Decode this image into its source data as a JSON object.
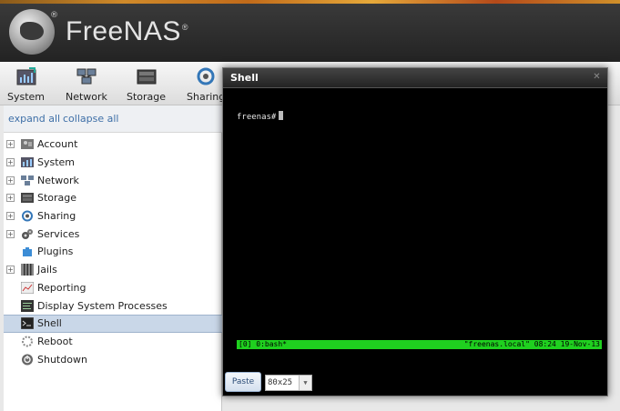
{
  "brand": {
    "name": "FreeNAS",
    "reg": "®"
  },
  "toolbar": [
    {
      "label": "System",
      "icon": "system-icon"
    },
    {
      "label": "Network",
      "icon": "network-icon"
    },
    {
      "label": "Storage",
      "icon": "storage-icon"
    },
    {
      "label": "Sharing",
      "icon": "sharing-icon"
    }
  ],
  "sidebar": {
    "expand_all": "expand all",
    "collapse_all": "collapse all",
    "items": [
      {
        "label": "Account",
        "expandable": true,
        "icon": "account-icon"
      },
      {
        "label": "System",
        "expandable": true,
        "icon": "system-icon"
      },
      {
        "label": "Network",
        "expandable": true,
        "icon": "network-icon"
      },
      {
        "label": "Storage",
        "expandable": true,
        "icon": "storage-icon"
      },
      {
        "label": "Sharing",
        "expandable": true,
        "icon": "sharing-icon"
      },
      {
        "label": "Services",
        "expandable": true,
        "icon": "services-icon"
      },
      {
        "label": "Plugins",
        "expandable": false,
        "icon": "plugins-icon"
      },
      {
        "label": "Jails",
        "expandable": true,
        "icon": "jails-icon"
      },
      {
        "label": "Reporting",
        "expandable": false,
        "icon": "reporting-icon"
      },
      {
        "label": "Display System Processes",
        "expandable": false,
        "icon": "processes-icon"
      },
      {
        "label": "Shell",
        "expandable": false,
        "icon": "shell-icon",
        "selected": true
      },
      {
        "label": "Reboot",
        "expandable": false,
        "icon": "reboot-icon"
      },
      {
        "label": "Shutdown",
        "expandable": false,
        "icon": "shutdown-icon"
      }
    ]
  },
  "shell": {
    "title": "Shell",
    "prompt": "freenas#",
    "status_left": "[0] 0:bash*",
    "status_right": "\"freenas.local\" 08:24 19-Nov-13",
    "paste_label": "Paste",
    "size_value": "80x25"
  },
  "colors": {
    "header": "#2e2e2e",
    "status_green": "#1fd01f",
    "selected_row": "#c9d7e8",
    "link": "#3e6fa7"
  }
}
